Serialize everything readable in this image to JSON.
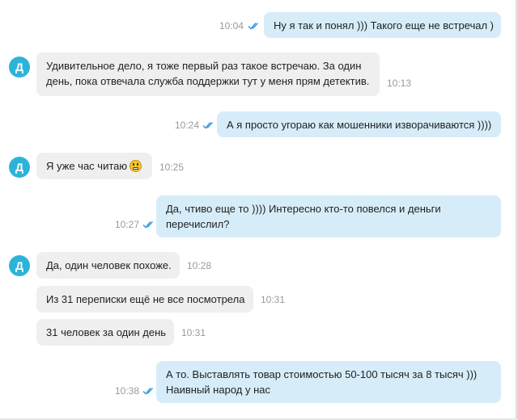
{
  "chat": {
    "avatar_letter": "Д",
    "messages": [
      {
        "id": "m1",
        "dir": "out",
        "time": "10:04",
        "read": true,
        "lines": [
          "Ну я так и понял ))) Такого еще не встречал )"
        ]
      },
      {
        "id": "m2",
        "dir": "in",
        "time": "10:13",
        "avatar": true,
        "lines": [
          "Удивительное дело, я тоже первый раз такое встречаю. За один",
          "день, пока отвечала служба поддержки тут у меня прям детектив."
        ]
      },
      {
        "id": "m3",
        "dir": "out",
        "time": "10:24",
        "read": true,
        "lines": [
          "А я просто угораю как мошенники изворачиваются ))))"
        ]
      },
      {
        "id": "m4",
        "dir": "in",
        "time": "10:25",
        "avatar": true,
        "lines": [
          "Я уже час читаю"
        ],
        "emoji": "grinning-face-icon"
      },
      {
        "id": "m5",
        "dir": "out",
        "time": "10:27",
        "read": true,
        "lines": [
          "Да, чтиво еще то )))) Интересно кто-то повелся и деньги",
          "перечислил?"
        ]
      },
      {
        "id": "m6",
        "dir": "in",
        "time": "10:28",
        "avatar": true,
        "lines": [
          "Да, один человек похоже."
        ]
      },
      {
        "id": "m7",
        "dir": "in",
        "time": "10:31",
        "lines": [
          "Из 31 переписки ещё не все посмотрела"
        ]
      },
      {
        "id": "m8",
        "dir": "in",
        "time": "10:31",
        "lines": [
          "31 человек за один день"
        ]
      },
      {
        "id": "m9",
        "dir": "out",
        "time": "10:38",
        "read": true,
        "lines": [
          "А то. Выставлять товар стоимостью 50-100 тысяч за 8 тысяч )))",
          "Наивный народ у нас"
        ]
      }
    ]
  },
  "colors": {
    "outgoing_bubble": "#d6edf9",
    "incoming_bubble": "#efefef",
    "avatar": "#2cb4d8",
    "read_check": "#3a9bd9",
    "time_text": "#9a9a9a"
  },
  "icons": {
    "read_receipt": "double-check-icon",
    "avatar": "avatar"
  }
}
